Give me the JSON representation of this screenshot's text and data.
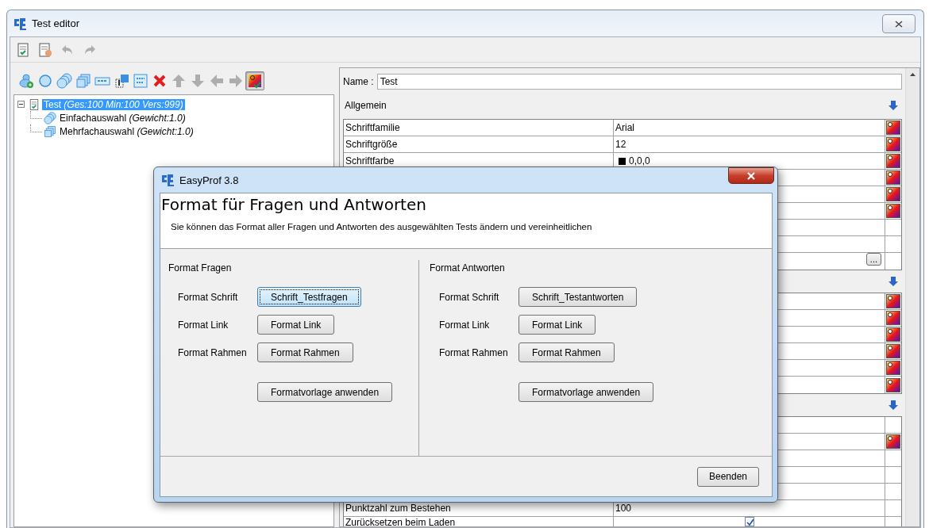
{
  "window": {
    "title": "Test editor"
  },
  "toolbar_1": [
    {
      "kind": "check-doc",
      "disabled": false
    },
    {
      "kind": "edit-doc",
      "disabled": false
    },
    {
      "kind": "undo",
      "disabled": true
    },
    {
      "kind": "redo",
      "disabled": true
    }
  ],
  "toolbar_2": [
    {
      "kind": "add-group",
      "pressed": false,
      "disabled": false
    },
    {
      "kind": "circle",
      "pressed": false,
      "disabled": false
    },
    {
      "kind": "circles",
      "pressed": false,
      "disabled": false
    },
    {
      "kind": "squares",
      "pressed": false,
      "disabled": false
    },
    {
      "kind": "abc-field",
      "pressed": false,
      "disabled": false
    },
    {
      "kind": "gradient-square",
      "pressed": false,
      "disabled": false
    },
    {
      "kind": "abc-block",
      "pressed": false,
      "disabled": false
    },
    {
      "kind": "delete",
      "pressed": false,
      "disabled": false
    },
    {
      "kind": "up",
      "pressed": false,
      "disabled": true
    },
    {
      "kind": "down",
      "pressed": false,
      "disabled": true
    },
    {
      "kind": "left",
      "pressed": false,
      "disabled": true
    },
    {
      "kind": "right",
      "pressed": false,
      "disabled": true
    },
    {
      "kind": "format",
      "pressed": true,
      "disabled": false
    }
  ],
  "tree": [
    {
      "label": "Test *(Ges:100 Min:100 Vers:999)*",
      "kind": "test",
      "selected": true,
      "expanded": true,
      "children": [
        {
          "label": "Einfachauswahl *(Gewicht:1.0)*",
          "kind": "single",
          "selected": false
        },
        {
          "label": "Mehrfachauswahl *(Gewicht:1.0)*",
          "kind": "multiple",
          "selected": false
        }
      ]
    }
  ],
  "properties": {
    "name_label": "Name :",
    "name_value": "Test",
    "sections": [
      {
        "title": "Allgemein",
        "rows": [
          {
            "kind": "text",
            "label": "Schriftfamilie",
            "value": "Arial",
            "format": true
          },
          {
            "kind": "text",
            "label": "Schriftgröße",
            "value": "12",
            "format": true
          },
          {
            "kind": "color",
            "label": "Schriftfarbe",
            "value": "0,0,0",
            "color": "#000000",
            "format": true
          },
          {
            "kind": "text",
            "format": true
          },
          {
            "kind": "text",
            "format": true
          },
          {
            "kind": "text",
            "format": true
          },
          {
            "kind": "text",
            "format": false
          },
          {
            "kind": "text",
            "format": false
          },
          {
            "kind": "button",
            "button": "...",
            "format": false
          }
        ]
      },
      {
        "rows": [
          {
            "kind": "text",
            "format": true
          },
          {
            "kind": "text",
            "format": true
          },
          {
            "kind": "text",
            "format": true
          },
          {
            "kind": "text",
            "format": true
          },
          {
            "kind": "text",
            "format": true
          },
          {
            "kind": "text",
            "format": true
          }
        ]
      },
      {
        "rows": [
          {
            "kind": "text",
            "format": false
          },
          {
            "kind": "text",
            "format": true
          },
          {
            "kind": "text",
            "format": false
          },
          {
            "kind": "text",
            "format": false
          },
          {
            "kind": "text",
            "format": false
          },
          {
            "kind": "text",
            "label": "Punktzahl zum Bestehen",
            "value": "100",
            "format": false
          },
          {
            "kind": "checkbox",
            "label": "Zurücksetzen beim Laden",
            "checked": true,
            "format": false
          }
        ]
      }
    ]
  },
  "dialog": {
    "title": "EasyProf 3.8",
    "heading": "Format für Fragen und Antworten",
    "description": "Sie können das Format aller Fragen und Antworten des ausgewählten Tests ändern und vereinheitlichen",
    "columns": [
      {
        "title": "Format Fragen",
        "rows": [
          {
            "label": "Format Schrift",
            "button": "Schrift_Testfragen",
            "focused": true
          },
          {
            "label": "Format Link",
            "button": "Format Link",
            "focused": false
          },
          {
            "label": "Format Rahmen",
            "button": "Format Rahmen",
            "focused": false
          }
        ],
        "apply_button": "Formatvorlage anwenden"
      },
      {
        "title": "Format Antworten",
        "rows": [
          {
            "label": "Format Schrift",
            "button": "Schrift_Testantworten",
            "focused": false
          },
          {
            "label": "Format Link",
            "button": "Format Link",
            "focused": false
          },
          {
            "label": "Format Rahmen",
            "button": "Format Rahmen",
            "focused": false
          }
        ],
        "apply_button": "Formatvorlage anwenden"
      }
    ],
    "close_button": "Beenden"
  }
}
